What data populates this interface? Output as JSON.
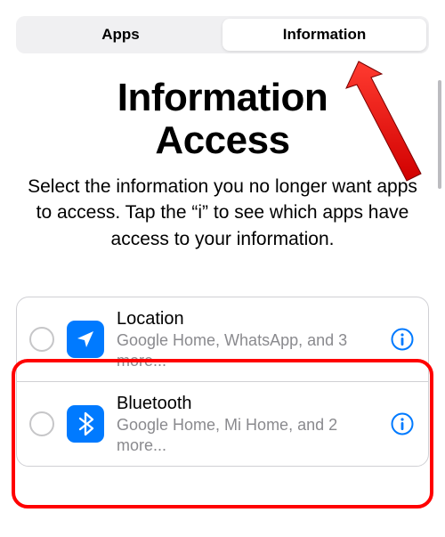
{
  "tabs": {
    "apps": "Apps",
    "information": "Information"
  },
  "title_line1": "Information",
  "title_line2": "Access",
  "subtitle": "Select the information you no longer want apps to access. Tap the “i” to see which apps have access to your information.",
  "rows": [
    {
      "icon": "location-arrow-icon",
      "title": "Location",
      "subtitle": "Google Home, WhatsApp, and 3 more..."
    },
    {
      "icon": "bluetooth-icon",
      "title": "Bluetooth",
      "subtitle": "Google Home, Mi Home, and 2 more..."
    }
  ],
  "colors": {
    "accent": "#007aff",
    "annotation": "#ff0000"
  }
}
